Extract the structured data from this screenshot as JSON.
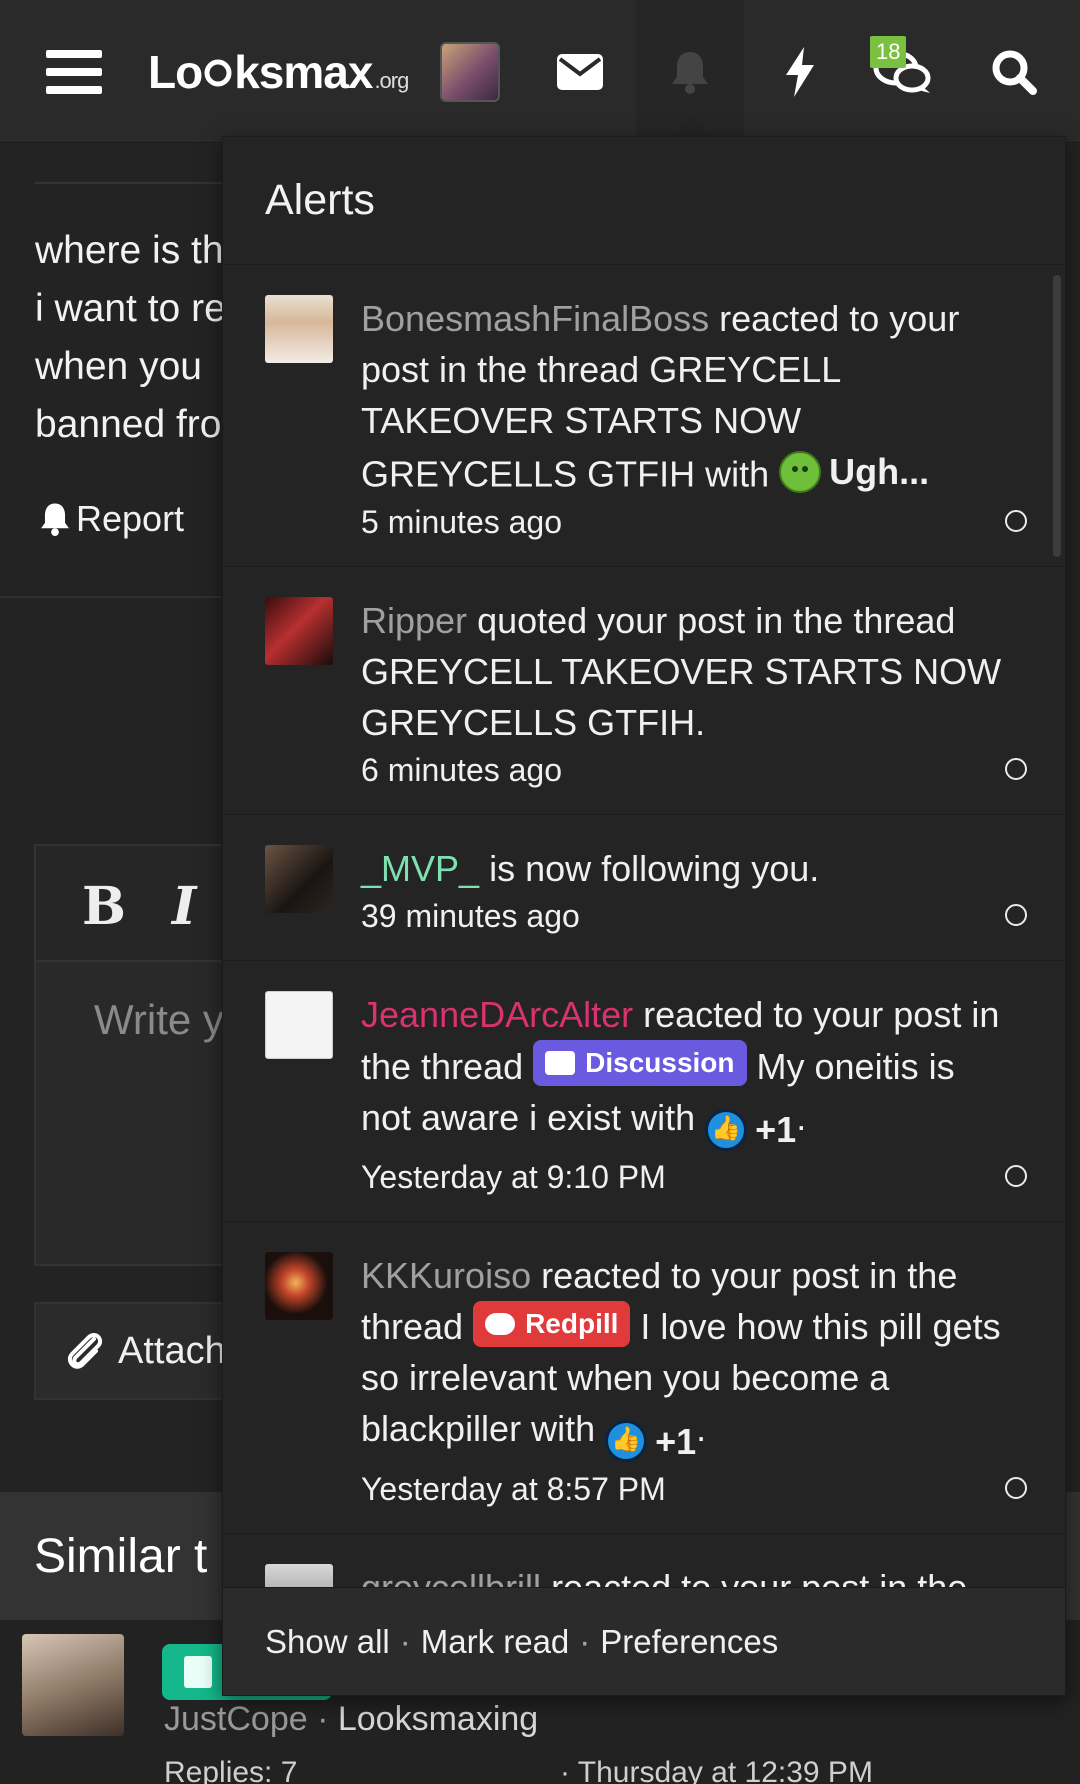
{
  "topbar": {
    "logo": "Lo",
    "logo_rest": "ksmax",
    "logo_suffix": ".org",
    "notification_badge": "18"
  },
  "background": {
    "post_lines": "where is th\ni want to re\nwhen you \nbanned fro",
    "report_label": "Report",
    "editor_placeholder": "Write y",
    "attach_label": "Attach",
    "similar_heading": "Similar t",
    "thread_author": "JustCope",
    "thread_forum": "Looksmaxing",
    "thread_replies": "Replies: 7",
    "thread_date": "· Thursday at 12:39 PM"
  },
  "alerts": {
    "title": "Alerts",
    "items": [
      {
        "user": "BonesmashFinalBoss",
        "text": " reacted to your post in the thread GREYCELL TAKEOVER STARTS NOW GREYCELLS GTFIH with ",
        "reaction": "Ugh...",
        "after": "",
        "time": "5 minutes ago"
      },
      {
        "user": "Ripper",
        "text": " quoted your post in the thread GREYCELL TAKEOVER STARTS NOW GREYCELLS GTFIH.",
        "time": "6 minutes ago"
      },
      {
        "user": "_MVP_",
        "text": " is now following you.",
        "time": "39 minutes ago"
      },
      {
        "user": "JeanneDArcAlter",
        "text_before": " reacted to your post in the thread ",
        "label": "Discussion",
        "text_after": " My oneitis is not aware i exist with ",
        "reaction": "+1",
        "after": ".",
        "time": "Yesterday at 9:10 PM"
      },
      {
        "user": "KKKuroiso",
        "text_before": " reacted to your post in the thread ",
        "label": "Redpill",
        "text_after": " I love how this pill gets so irrelevant when you become a blackpiller with ",
        "reaction": "+1",
        "after": ".",
        "time": "Yesterday at 8:57 PM"
      },
      {
        "user": "greycellbrill",
        "text": " reacted to your post in the"
      }
    ],
    "footer": {
      "show_all": "Show all",
      "mark_read": "Mark read",
      "preferences": "Preferences",
      "separator": "·"
    }
  },
  "colors": {
    "accent_green": "#7ac142",
    "discussion": "#6a5ae0",
    "redpill": "#e03a3a",
    "mvp": "#7ee0b0",
    "jeanne": "#d9326f"
  }
}
